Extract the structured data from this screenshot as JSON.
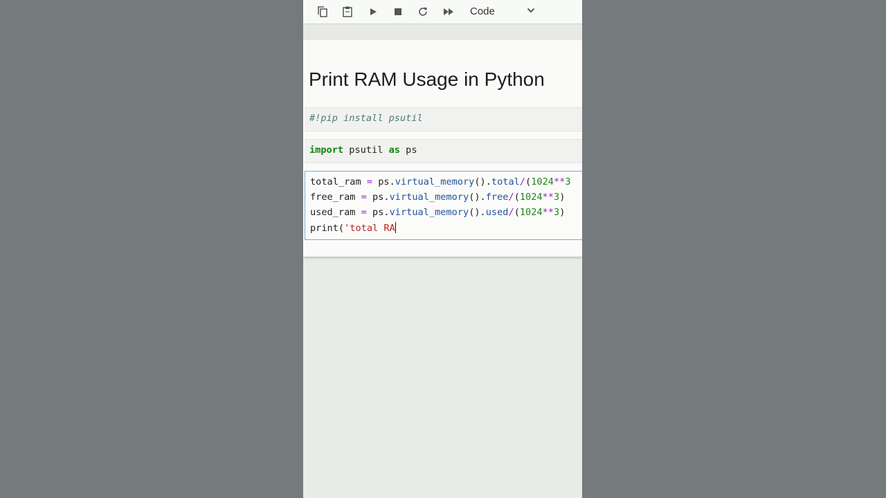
{
  "toolbar": {
    "buttons": [
      {
        "name": "copy-cells",
        "icon": "copy-icon"
      },
      {
        "name": "paste-cells",
        "icon": "clipboard-icon"
      },
      {
        "name": "run-cell",
        "icon": "play-icon"
      },
      {
        "name": "interrupt-kernel",
        "icon": "stop-icon"
      },
      {
        "name": "restart-kernel",
        "icon": "refresh-icon"
      },
      {
        "name": "restart-run-all",
        "icon": "fast-forward-icon"
      }
    ],
    "cell_type": "Code",
    "cell_type_icon": "chevron-down-icon"
  },
  "notebook": {
    "heading": "Print RAM Usage in Python",
    "cells": [
      {
        "kind": "code",
        "text": "#!pip install psutil"
      },
      {
        "kind": "code",
        "text": "import psutil as ps"
      },
      {
        "kind": "code",
        "active": true,
        "lines": [
          "total_ram = ps.virtual_memory().total/(1024**3",
          "free_ram = ps.virtual_memory().free/(1024**3)",
          "used_ram = ps.virtual_memory().used/(1024**3)",
          "print('total RA"
        ]
      }
    ]
  },
  "tokens": {
    "comment": "#!pip install psutil",
    "import_kw": "import",
    "module": " psutil ",
    "as_kw": "as",
    "alias": " ps",
    "total_var": "total_ram ",
    "free_var": "free_ram ",
    "used_var": "used_ram ",
    "eq": "=",
    "ps_obj": " ps.",
    "vm_call": "virtual_memory",
    "parens": "().",
    "total_attr": "total",
    "free_attr": "free",
    "used_attr": "used",
    "div_op": "/",
    "open_paren": "(",
    "num_1024": "1024",
    "pow_op": "**",
    "num_3": "3",
    "close_paren": ")",
    "print_fn": "print(",
    "str_partial": "'total RA"
  },
  "colors": {
    "page_background": "#757b7d",
    "notebook_background": "#fafbf9",
    "keyword": "#14830f",
    "property": "#23529a",
    "number": "#20851a",
    "operator": "#9a22c8",
    "string": "#b8261f",
    "comment": "#4c7b7d",
    "active_cell_border": "#7aa7d0"
  }
}
